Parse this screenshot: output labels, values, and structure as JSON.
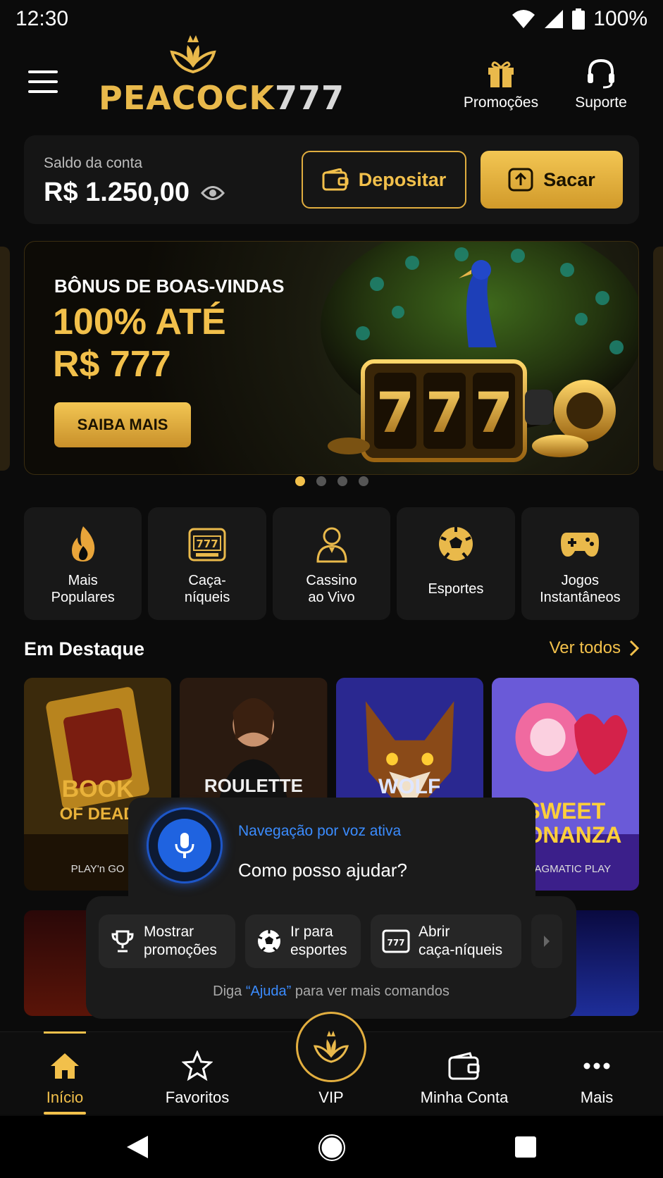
{
  "status_bar": {
    "time": "12:30",
    "battery": "100%"
  },
  "header": {
    "logo": {
      "part1": "PEACOCK",
      "part2": "777"
    },
    "promotions_label": "Promoções",
    "support_label": "Suporte"
  },
  "balance": {
    "label": "Saldo da conta",
    "value": "R$ 1.250,00",
    "deposit_label": "Depositar",
    "withdraw_label": "Sacar"
  },
  "banner": {
    "subtitle": "BÔNUS DE BOAS-VINDAS",
    "title_line1": "100% ATÉ",
    "title_line2": "R$ 777",
    "cta": "SAIBA MAIS",
    "slide_count": 4,
    "active_slide": 1
  },
  "categories": [
    {
      "label_line1": "Mais",
      "label_line2": "Populares",
      "icon": "flame-icon"
    },
    {
      "label_line1": "Caça-",
      "label_line2": "níqueis",
      "icon": "slot-machine-icon"
    },
    {
      "label_line1": "Cassino",
      "label_line2": "ao Vivo",
      "icon": "dealer-icon"
    },
    {
      "label_line1": "Esportes",
      "label_line2": "",
      "icon": "soccer-ball-icon"
    },
    {
      "label_line1": "Jogos",
      "label_line2": "Instantâneos",
      "icon": "gamepad-icon"
    }
  ],
  "featured": {
    "title": "Em Destaque",
    "see_all": "Ver todos",
    "games": [
      {
        "name_line1": "BOOK",
        "name_line2": "OF DEAD",
        "provider": "PLAY'n GO"
      },
      {
        "name_line1": "ROULETTE",
        "name_line2": "",
        "provider": ""
      },
      {
        "name_line1": "WOLF",
        "name_line2": "",
        "provider": ""
      },
      {
        "name_line1": "SWEET",
        "name_line2": "BONANZA",
        "provider": "PRAGMATIC PLAY"
      }
    ]
  },
  "voice": {
    "status": "Navegação por voz ativa",
    "question": "Como posso ajudar?",
    "chips": [
      {
        "line1": "Mostrar",
        "line2": "promoções",
        "icon": "trophy-icon"
      },
      {
        "line1": "Ir para",
        "line2": "esportes",
        "icon": "soccer-ball-icon"
      },
      {
        "line1": "Abrir",
        "line2": "caça-níqueis",
        "icon": "slot-machine-icon"
      }
    ],
    "hint_prefix": "Diga ",
    "hint_keyword": "“Ajuda”",
    "hint_suffix": " para ver mais comandos"
  },
  "bottom_nav": [
    {
      "label": "Início",
      "active": true
    },
    {
      "label": "Favoritos",
      "active": false
    },
    {
      "label": "VIP",
      "active": false
    },
    {
      "label": "Minha Conta",
      "active": false
    },
    {
      "label": "Mais",
      "active": false
    }
  ],
  "colors": {
    "accent": "#f2c04b",
    "background": "#0b0b0b",
    "voice_blue": "#3b8cff"
  }
}
